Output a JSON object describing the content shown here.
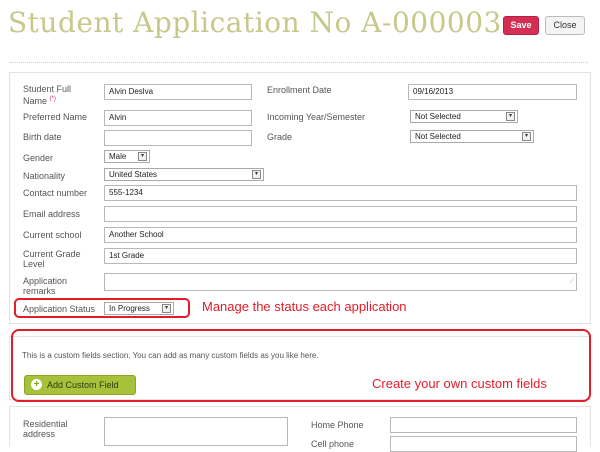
{
  "header": {
    "title": "Student Application No A-000003",
    "save_label": "Save",
    "close_label": "Close"
  },
  "form": {
    "full_name_label_1": "Student Full",
    "full_name_label_2": "Name",
    "required_mark": "(*)",
    "full_name_value": "Alvin Deslva",
    "enrollment_label": "Enrollment Date",
    "enrollment_value": "09/16/2013",
    "preferred_label": "Preferred Name",
    "preferred_value": "Alvin",
    "incoming_label": "Incoming Year/Semester",
    "incoming_value": "Not Selected",
    "birth_label": "Birth date",
    "birth_value": "",
    "grade_label": "Grade",
    "grade_value": "Not Selected",
    "gender_label": "Gender",
    "gender_value": "Male",
    "nationality_label": "Nationality",
    "nationality_value": "United States",
    "contact_label": "Contact number",
    "contact_value": "555-1234",
    "email_label": "Email address",
    "email_value": "",
    "school_label": "Current school",
    "school_value": "Another School",
    "grade_level_label_1": "Current Grade",
    "grade_level_label_2": "Level",
    "grade_level_value": "1st Grade",
    "remarks_label_1": "Application",
    "remarks_label_2": "remarks",
    "remarks_value": "",
    "status_label": "Application Status",
    "status_value": "In Progress"
  },
  "annotations": {
    "status_note": "Manage the status each application",
    "custom_note": "Create your own custom fields"
  },
  "custom": {
    "description": "This is a custom fields section. You can add as many custom fields as you like here.",
    "add_label": "Add Custom Field"
  },
  "address": {
    "residential_label_1": "Residential",
    "residential_label_2": "address",
    "home_phone_label": "Home Phone",
    "cell_phone_label": "Cell phone"
  },
  "icons": {
    "dropdown": "▾",
    "plus": "+",
    "grip": "⟋"
  },
  "colors": {
    "title": "#c6c98a",
    "save": "#d32f54",
    "callout": "#e21d2a",
    "add_button": "#a7c13a"
  }
}
